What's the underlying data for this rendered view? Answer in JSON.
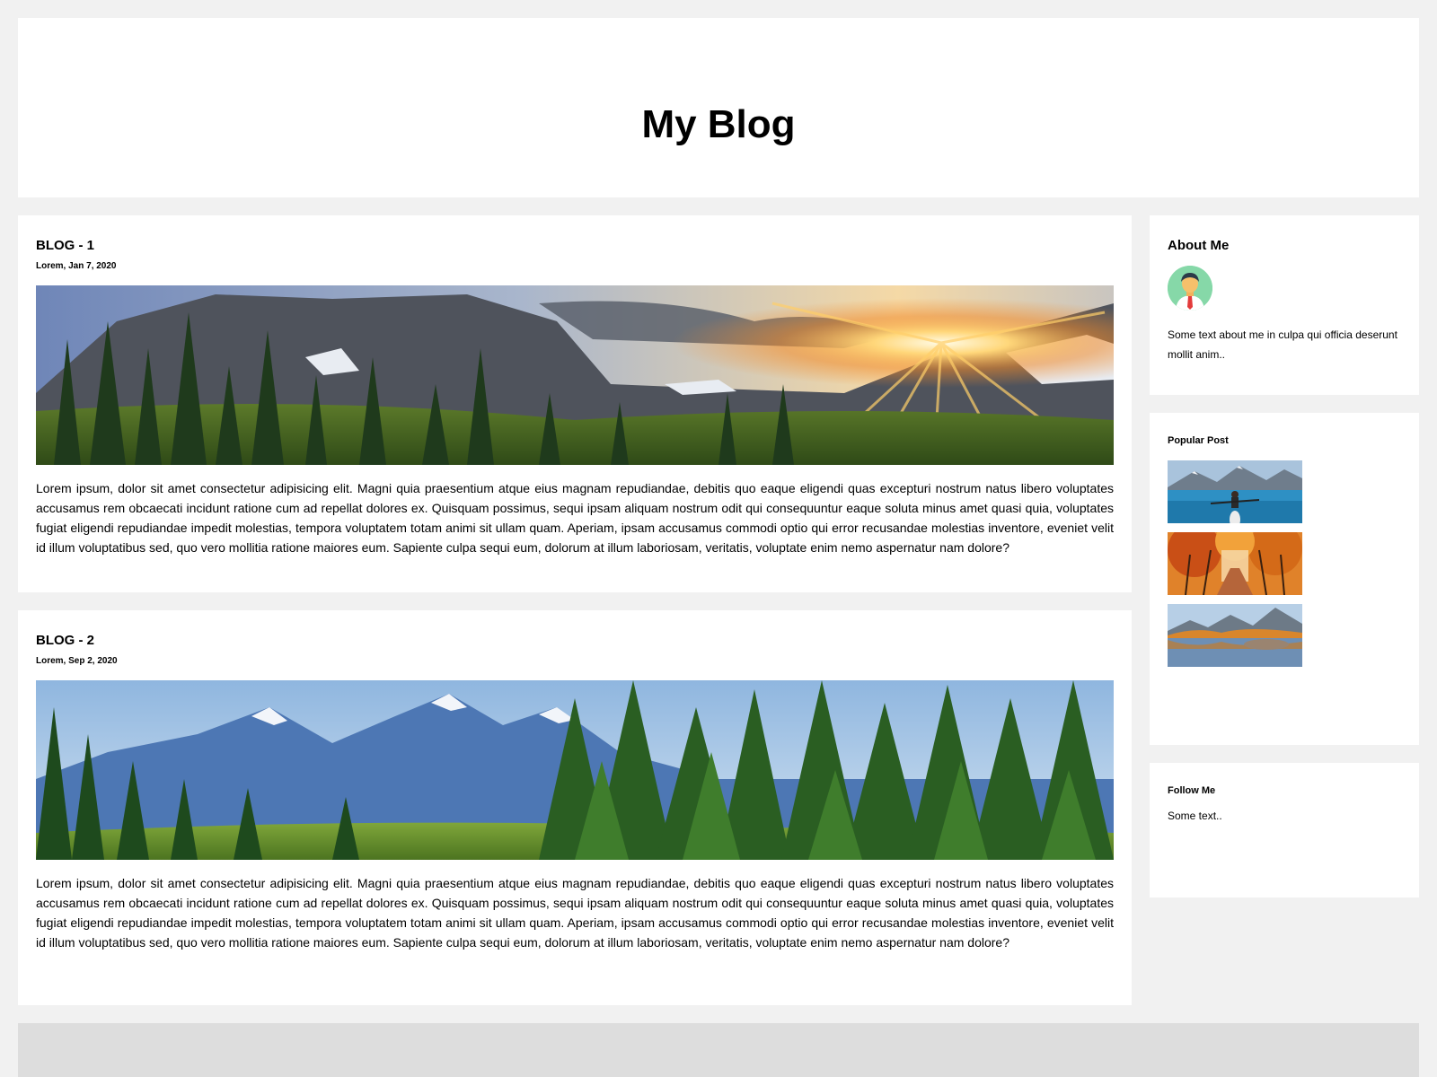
{
  "header": {
    "title": "My Blog"
  },
  "posts": [
    {
      "title": "BLOG - 1",
      "date": "Lorem, Jan 7, 2020",
      "image": "sunset-mountain-forest-photo",
      "body": "Lorem ipsum, dolor sit amet consectetur adipisicing elit. Magni quia praesentium atque eius magnam repudiandae, debitis quo eaque eligendi quas excepturi nostrum natus libero voluptates accusamus rem obcaecati incidunt ratione cum ad repellat dolores ex. Quisquam possimus, sequi ipsam aliquam nostrum odit qui consequuntur eaque soluta minus amet quasi quia, voluptates fugiat eligendi repudiandae impedit molestias, tempora voluptatem totam animi sit ullam quam. Aperiam, ipsam accusamus commodi optio qui error recusandae molestias inventore, eveniet velit id illum voluptatibus sed, quo vero mollitia ratione maiores eum. Sapiente culpa sequi eum, dolorum at illum laboriosam, veritatis, voluptate enim nemo aspernatur nam dolore?"
    },
    {
      "title": "BLOG - 2",
      "date": "Lorem, Sep 2, 2020",
      "image": "pine-forest-mountains-photo",
      "body": "Lorem ipsum, dolor sit amet consectetur adipisicing elit. Magni quia praesentium atque eius magnam repudiandae, debitis quo eaque eligendi quas excepturi nostrum natus libero voluptates accusamus rem obcaecati incidunt ratione cum ad repellat dolores ex. Quisquam possimus, sequi ipsam aliquam nostrum odit qui consequuntur eaque soluta minus amet quasi quia, voluptates fugiat eligendi repudiandae impedit molestias, tempora voluptatem totam animi sit ullam quam. Aperiam, ipsam accusamus commodi optio qui error recusandae molestias inventore, eveniet velit id illum voluptatibus sed, quo vero mollitia ratione maiores eum. Sapiente culpa sequi eum, dolorum at illum laboriosam, veritatis, voluptate enim nemo aspernatur nam dolore?"
    }
  ],
  "sidebar": {
    "about": {
      "title": "About Me",
      "avatar": "person-avatar-icon",
      "text": "Some text about me in culpa qui officia deserunt mollit anim.."
    },
    "popular": {
      "title": "Popular Post",
      "thumbnails": [
        "kayak-lake-mountains-photo",
        "autumn-forest-road-photo",
        "autumn-lake-reflection-photo"
      ]
    },
    "follow": {
      "title": "Follow Me",
      "text": "Some text.."
    }
  },
  "colors": {
    "page_background": "#f1f1f1",
    "card_background": "#ffffff",
    "footer_background": "#dddddd"
  }
}
